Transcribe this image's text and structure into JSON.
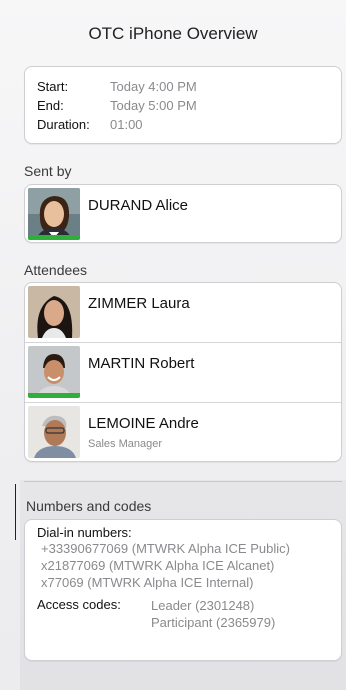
{
  "header": {
    "title": "OTC iPhone Overview"
  },
  "time": {
    "start_label": "Start:",
    "start_value": "Today 4:00 PM",
    "end_label": "End:",
    "end_value": "Today 5:00 PM",
    "duration_label": "Duration:",
    "duration_value": "01:00"
  },
  "sent_by": {
    "section_label": "Sent by",
    "name": "DURAND Alice",
    "presence_color": "#2fae3c"
  },
  "attendees": {
    "section_label": "Attendees",
    "items": [
      {
        "name": "ZIMMER Laura",
        "subtitle": ""
      },
      {
        "name": "MARTIN Robert",
        "subtitle": ""
      },
      {
        "name": "LEMOINE Andre",
        "subtitle": "Sales Manager"
      }
    ]
  },
  "codes": {
    "section_label": "Numbers and codes",
    "dial_in_label": "Dial-in numbers:",
    "numbers": [
      "+33390677069 (MTWRK Alpha ICE Public)",
      "x21877069 (MTWRK Alpha ICE Alcanet)",
      "x77069 (MTWRK Alpha ICE Internal)"
    ],
    "access_label": "Access codes:",
    "access_values": [
      "Leader (2301248)",
      "Participant (2365979)"
    ]
  }
}
